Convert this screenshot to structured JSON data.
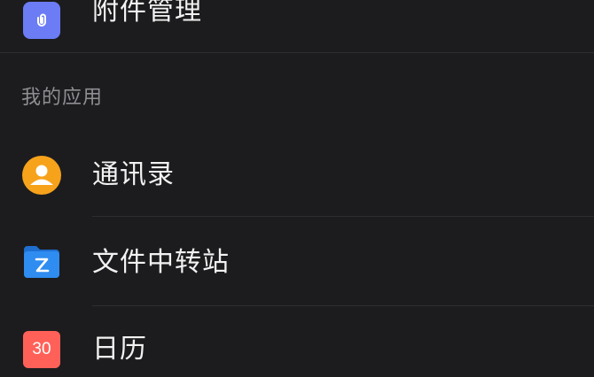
{
  "attachments": {
    "label": "附件管理",
    "icon": "attachment-icon",
    "color": "#6b7cf5"
  },
  "section_header": "我的应用",
  "apps": [
    {
      "label": "通讯录",
      "icon": "contacts-icon",
      "color": "#f6a21b"
    },
    {
      "label": "文件中转站",
      "icon": "file-transfer-icon",
      "color": "#2f8cf0"
    },
    {
      "label": "日历",
      "icon": "calendar-icon",
      "color": "#ff6159",
      "badge": "30"
    }
  ]
}
